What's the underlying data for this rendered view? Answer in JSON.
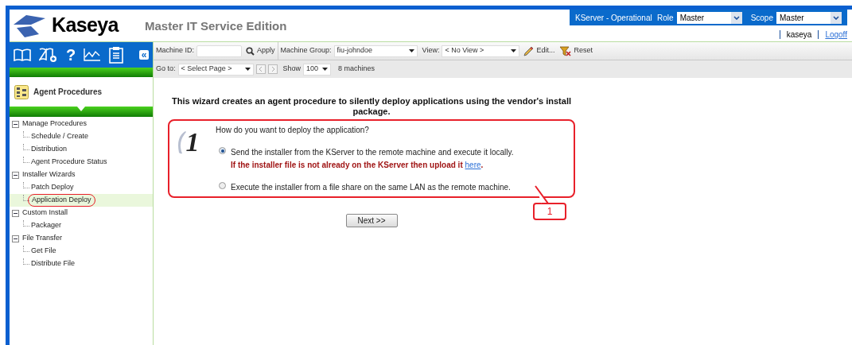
{
  "header": {
    "logo": "Kaseya",
    "edition": "Master IT Service Edition",
    "server_status": "KServer - Operational",
    "role": {
      "label": "Role",
      "value": "Master"
    },
    "scope": {
      "label": "Scope",
      "value": "Master"
    },
    "user": "kaseya",
    "logoff": "Logoff"
  },
  "nav_icons": {
    "help": "?",
    "collapse": "«"
  },
  "toolbar": {
    "machine_id": {
      "label": "Machine ID:"
    },
    "apply": "Apply",
    "machine_group": {
      "label": "Machine Group:",
      "value": "fiu-johndoe"
    },
    "view": {
      "label": "View:",
      "value": "< No View >"
    },
    "edit": "Edit...",
    "reset": "Reset",
    "goto": {
      "label": "Go to:",
      "value": "< Select Page >"
    },
    "show": {
      "label": "Show",
      "value": "100"
    },
    "machine_count": "8 machines"
  },
  "sidebar": {
    "module": "Agent Procedures",
    "tree": [
      {
        "label": "Manage Procedures",
        "expanded": true,
        "children": [
          {
            "label": "Schedule / Create",
            "selected": false
          },
          {
            "label": "Distribution",
            "selected": false
          },
          {
            "label": "Agent Procedure Status",
            "selected": false
          }
        ]
      },
      {
        "label": "Installer Wizards",
        "expanded": true,
        "children": [
          {
            "label": "Patch Deploy",
            "selected": false
          },
          {
            "label": "Application Deploy",
            "selected": true
          }
        ]
      },
      {
        "label": "Custom Install",
        "expanded": true,
        "children": [
          {
            "label": "Packager",
            "selected": false
          }
        ]
      },
      {
        "label": "File Transfer",
        "expanded": true,
        "children": [
          {
            "label": "Get File",
            "selected": false
          },
          {
            "label": "Distribute File",
            "selected": false
          }
        ]
      }
    ]
  },
  "wizard": {
    "intro": "This wizard creates an agent procedure to silently deploy applications using the vendor's install package.",
    "step": "1",
    "question": "How do you want to deploy the application?",
    "options": [
      {
        "label": "Send the installer from the KServer to the remote machine and execute it locally.",
        "note": "If the installer file is not already on the KServer then upload it",
        "link": "here",
        "note_end": ".",
        "selected": true
      },
      {
        "label": "Execute the installer from a file share on the same LAN as the remote machine.",
        "selected": false
      }
    ],
    "next_button": "Next >>",
    "callout": "1"
  }
}
